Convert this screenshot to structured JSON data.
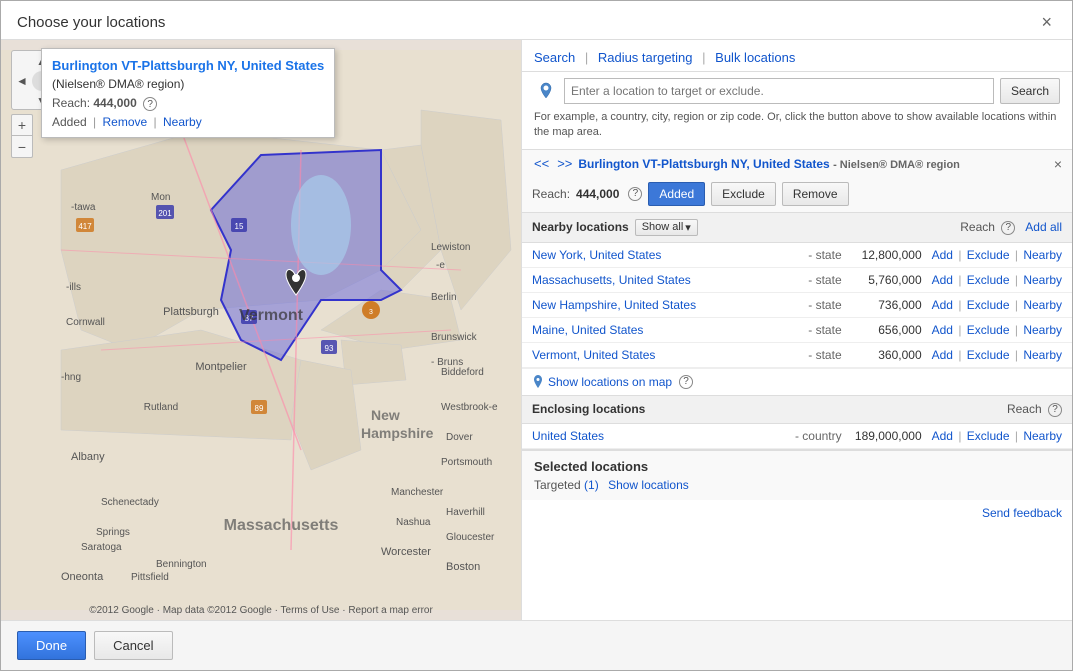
{
  "dialog": {
    "title": "Choose your locations",
    "close_label": "×"
  },
  "map": {
    "tooltip": {
      "title": "Burlington VT-Plattsburgh NY, United States",
      "subtitle": "(Nielsen® DMA® region)",
      "reach_label": "Reach:",
      "reach_value": "444,000",
      "actions": {
        "added": "Added",
        "remove": "Remove",
        "nearby": "Nearby"
      }
    },
    "controls": {
      "zoom_in": "+",
      "zoom_out": "−",
      "pan_up": "▲",
      "pan_down": "▼",
      "pan_left": "◄",
      "pan_right": "►"
    },
    "attribution": "©2012 Google · Map data ©2012 Google · Terms of Use · Report a map error"
  },
  "panel": {
    "tabs": {
      "search": "Search",
      "radius_targeting": "Radius targeting",
      "bulk_locations": "Bulk locations"
    },
    "search": {
      "placeholder": "Enter a location to target or exclude.",
      "button": "Search",
      "hint": "For example, a country, city, region or zip code. Or, click the button above to show available locations within the map area."
    },
    "location_detail": {
      "back": "<<",
      "forward": ">>",
      "title": "Burlington VT-Plattsburgh NY, United States",
      "subtitle": "- Nielsen® DMA® region",
      "close": "×",
      "reach_label": "Reach:",
      "reach_value": "444,000",
      "buttons": {
        "added": "Added",
        "exclude": "Exclude",
        "remove": "Remove"
      }
    },
    "nearby": {
      "title": "Nearby locations",
      "show_all": "Show all",
      "reach_header": "Reach",
      "add_all": "Add all",
      "locations": [
        {
          "name": "New York, United States",
          "type": "- state",
          "reach": "12,800,000",
          "actions": [
            "Add",
            "Exclude",
            "Nearby"
          ]
        },
        {
          "name": "Massachusetts, United States",
          "type": "- state",
          "reach": "5,760,000",
          "actions": [
            "Add",
            "Exclude",
            "Nearby"
          ]
        },
        {
          "name": "New Hampshire, United States",
          "type": "- state",
          "reach": "736,000",
          "actions": [
            "Add",
            "Exclude",
            "Nearby"
          ]
        },
        {
          "name": "Maine, United States",
          "type": "- state",
          "reach": "656,000",
          "actions": [
            "Add",
            "Exclude",
            "Nearby"
          ]
        },
        {
          "name": "Vermont, United States",
          "type": "- state",
          "reach": "360,000",
          "actions": [
            "Add",
            "Exclude",
            "Nearby"
          ]
        }
      ],
      "show_on_map": "Show locations on map"
    },
    "enclosing": {
      "title": "Enclosing locations",
      "reach_header": "Reach",
      "locations": [
        {
          "name": "United States",
          "type": "- country",
          "reach": "189,000,000",
          "actions": [
            "Add",
            "Exclude",
            "Nearby"
          ]
        }
      ]
    },
    "selected": {
      "title": "Selected locations",
      "targeted_label": "Targeted",
      "targeted_count": "(1)",
      "show_locations": "Show locations"
    },
    "feedback": "Send feedback"
  },
  "footer": {
    "done": "Done",
    "cancel": "Cancel"
  }
}
